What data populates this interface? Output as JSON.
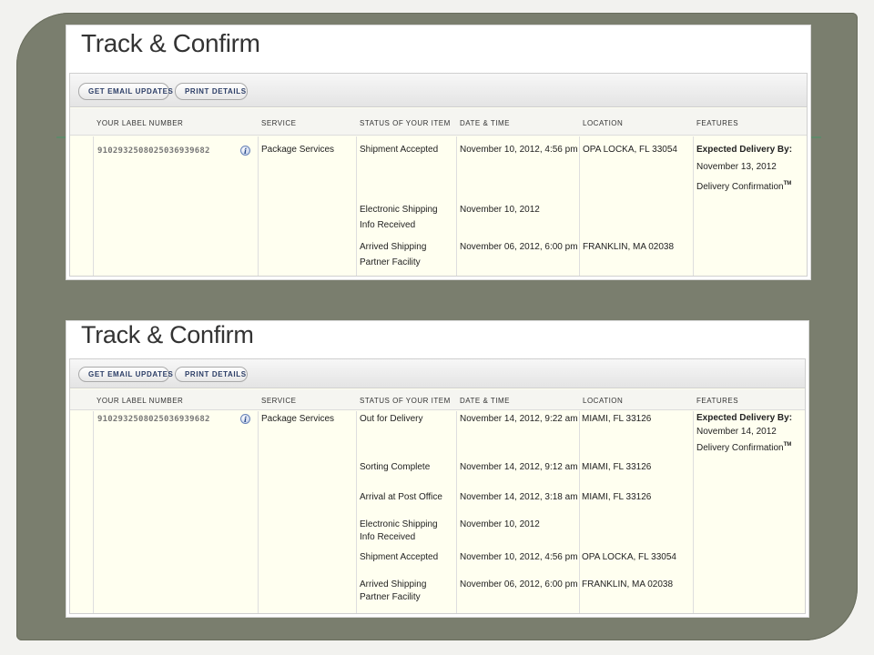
{
  "panels": [
    {
      "title": "Track & Confirm",
      "buttons": {
        "email": "GET EMAIL UPDATES",
        "print": "PRINT DETAILS"
      },
      "headers": [
        "YOUR LABEL NUMBER",
        "SERVICE",
        "STATUS OF YOUR ITEM",
        "DATE & TIME",
        "LOCATION",
        "FEATURES"
      ],
      "label_number": "9102932508025036939682",
      "service": "Package Services",
      "events": [
        {
          "status": "Shipment Accepted",
          "datetime": "November 10, 2012, 4:56 pm",
          "location": "OPA LOCKA, FL 33054"
        },
        {
          "status": "Electronic Shipping Info Received",
          "datetime": "November 10, 2012",
          "location": ""
        },
        {
          "status": "Arrived Shipping Partner Facility",
          "datetime": "November 06, 2012, 6:00 pm",
          "location": "FRANKLIN, MA 02038"
        }
      ],
      "features": {
        "expected_title": "Expected Delivery By:",
        "expected_date": "November 13, 2012",
        "confirmation": "Delivery Confirmation",
        "tm": "TM"
      }
    },
    {
      "title": "Track & Confirm",
      "buttons": {
        "email": "GET EMAIL UPDATES",
        "print": "PRINT DETAILS"
      },
      "headers": [
        "YOUR LABEL NUMBER",
        "SERVICE",
        "STATUS OF YOUR ITEM",
        "DATE & TIME",
        "LOCATION",
        "FEATURES"
      ],
      "label_number": "9102932508025036939682",
      "service": "Package Services",
      "events": [
        {
          "status": "Out for Delivery",
          "datetime": "November 14, 2012, 9:22 am",
          "location": "MIAMI, FL 33126"
        },
        {
          "status": "Sorting Complete",
          "datetime": "November 14, 2012, 9:12 am",
          "location": "MIAMI, FL 33126"
        },
        {
          "status": "Arrival at Post Office",
          "datetime": "November 14, 2012, 3:18 am",
          "location": "MIAMI, FL 33126"
        },
        {
          "status": "Electronic Shipping Info Received",
          "datetime": "November 10, 2012",
          "location": ""
        },
        {
          "status": "Shipment Accepted",
          "datetime": "November 10, 2012, 4:56 pm",
          "location": "OPA LOCKA, FL 33054"
        },
        {
          "status": "Arrived Shipping Partner Facility",
          "datetime": "November 06, 2012, 6:00 pm",
          "location": "FRANKLIN, MA 02038"
        }
      ],
      "features": {
        "expected_title": "Expected Delivery By:",
        "expected_date": "November 14, 2012",
        "confirmation": "Delivery Confirmation",
        "tm": "TM"
      }
    }
  ],
  "info_icon": {
    "glyph": "i",
    "name": "info-icon"
  },
  "colors": {
    "frame": "#7a7e6e",
    "accent_line": "#5f8a6a",
    "table_bg": "#fffff0",
    "button_text": "#2b3d66"
  }
}
